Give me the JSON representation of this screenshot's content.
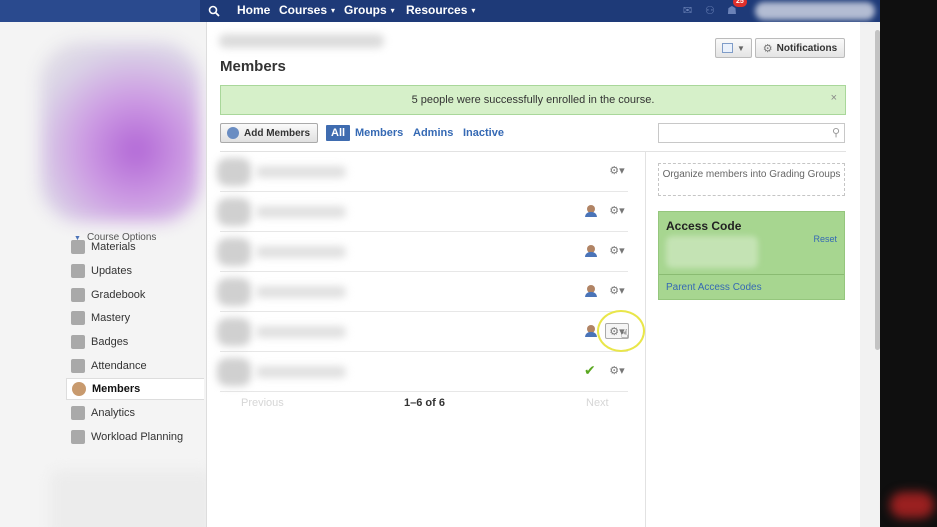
{
  "topnav": {
    "items": [
      {
        "label": "Home",
        "caret": ""
      },
      {
        "label": "Courses",
        "caret": "▾"
      },
      {
        "label": "Groups",
        "caret": "▾"
      },
      {
        "label": "Resources",
        "caret": "▾"
      }
    ],
    "notification_count": "25"
  },
  "sidebar": {
    "course_options": "Course Options",
    "items": [
      {
        "label": "Materials",
        "icon": "materials-icon"
      },
      {
        "label": "Updates",
        "icon": "updates-icon"
      },
      {
        "label": "Gradebook",
        "icon": "gradebook-icon"
      },
      {
        "label": "Mastery",
        "icon": "mastery-icon"
      },
      {
        "label": "Badges",
        "icon": "badges-icon"
      },
      {
        "label": "Attendance",
        "icon": "attendance-icon"
      },
      {
        "label": "Members",
        "icon": "members-icon",
        "active": true
      },
      {
        "label": "Analytics",
        "icon": "analytics-icon"
      },
      {
        "label": "Workload Planning",
        "icon": "workload-icon"
      }
    ]
  },
  "main": {
    "title": "Members",
    "notifications_label": "Notifications",
    "banner": {
      "message": "5 people were successfully enrolled in the course.",
      "close": "×"
    },
    "add_members_label": "Add Members",
    "filters": [
      {
        "label": "All",
        "selected": true
      },
      {
        "label": "Members"
      },
      {
        "label": "Admins"
      },
      {
        "label": "Inactive"
      }
    ],
    "members": [
      {
        "role": "none"
      },
      {
        "role": "admin"
      },
      {
        "role": "admin"
      },
      {
        "role": "admin"
      },
      {
        "role": "admin",
        "hover": true
      },
      {
        "role": "enrolled-check"
      }
    ],
    "pager": {
      "previous": "Previous",
      "count": "1–6 of 6",
      "next": "Next"
    }
  },
  "right_column": {
    "grading_groups": "Organize members into Grading Groups",
    "access_code_title": "Access Code",
    "reset_label": "Reset",
    "parent_codes_label": "Parent Access Codes"
  },
  "colors": {
    "topbar": "#1e3a78",
    "banner": "#d6f0c9",
    "access_box": "#a7d690",
    "link": "#3569b4"
  }
}
